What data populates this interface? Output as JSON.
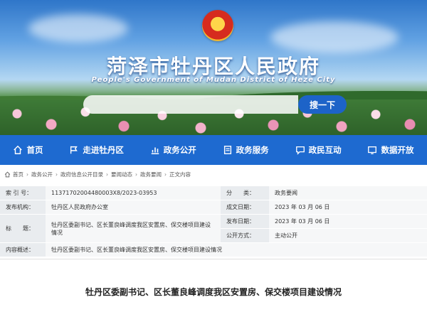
{
  "header": {
    "title": "菏泽市牡丹区人民政府",
    "subtitle": "People's Government of Mudan District of Heze City",
    "search_placeholder": "",
    "search_button": "搜一下"
  },
  "nav": {
    "items": [
      {
        "label": "首页",
        "icon": "home-icon"
      },
      {
        "label": "走进牡丹区",
        "icon": "flag-icon"
      },
      {
        "label": "政务公开",
        "icon": "chart-icon"
      },
      {
        "label": "政务服务",
        "icon": "document-icon"
      },
      {
        "label": "政民互动",
        "icon": "chat-icon"
      },
      {
        "label": "数据开放",
        "icon": "data-icon"
      }
    ]
  },
  "breadcrumb": [
    "首页",
    "政务公开",
    "政府信息公开目录",
    "要闻动态",
    "政务要闻",
    "正文内容"
  ],
  "meta": {
    "index_label": "索 引 号：",
    "index_value": "11371702004480003X8/2023-03953",
    "category_label": "分　　类：",
    "category_value": "政务要闻",
    "publisher_label": "发布机构：",
    "publisher_value": "牡丹区人民政府办公室",
    "created_label": "成文日期：",
    "created_value": "2023 年 03 月 06 日",
    "title_label": "标　　题：",
    "title_value": "牡丹区委副书记、区长董良峰调度我区安置房、保交楼项目建设情况",
    "published_label": "发布日期：",
    "published_value": "2023 年 03 月 06 日",
    "disclosure_label": "公开方式：",
    "disclosure_value": "主动公开",
    "summary_label": "内容概述：",
    "summary_value": "牡丹区委副书记、区长董良峰调度我区安置房、保交楼项目建设情况"
  },
  "article": {
    "title": "牡丹区委副书记、区长董良峰调度我区安置房、保交楼项目建设情况"
  },
  "colors": {
    "nav_blue": "#1e6ad0",
    "search_button": "#1d63c8"
  }
}
